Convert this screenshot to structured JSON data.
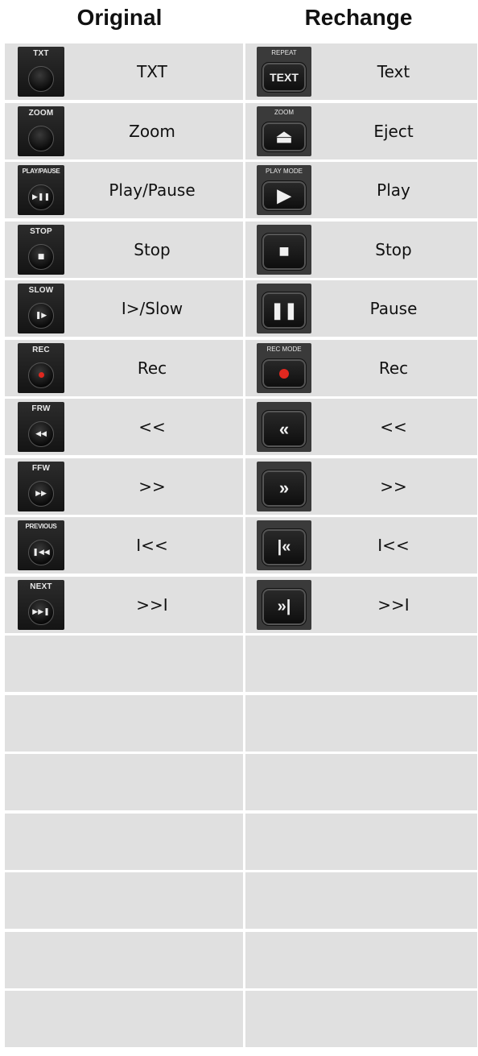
{
  "header": {
    "left_title": "Original",
    "right_title": "Rechange"
  },
  "rows": [
    {
      "original": {
        "icon": "txt-button-icon",
        "caption": "TXT",
        "symbol": "",
        "label": "TXT"
      },
      "rechange": {
        "icon": "repeat-text-button-icon",
        "caption": "REPEAT",
        "symbol": "TEXT",
        "label": "Text"
      }
    },
    {
      "original": {
        "icon": "zoom-button-icon",
        "caption": "ZOOM",
        "symbol": "",
        "label": "Zoom"
      },
      "rechange": {
        "icon": "zoom-eject-button-icon",
        "caption": "ZOOM",
        "symbol": "⏏",
        "label": "Eject"
      }
    },
    {
      "original": {
        "icon": "play-pause-button-icon",
        "caption": "PLAY/PAUSE",
        "symbol": "▶❚❚",
        "label": "Play/Pause"
      },
      "rechange": {
        "icon": "play-mode-button-icon",
        "caption": "PLAY MODE",
        "symbol": "▶",
        "label": "Play"
      }
    },
    {
      "original": {
        "icon": "stop-button-icon",
        "caption": "STOP",
        "symbol": "■",
        "label": "Stop"
      },
      "rechange": {
        "icon": "stop-button-icon",
        "caption": "",
        "symbol": "■",
        "label": "Stop"
      }
    },
    {
      "original": {
        "icon": "slow-button-icon",
        "caption": "SLOW",
        "symbol": "❚▶",
        "label": "I>/Slow"
      },
      "rechange": {
        "icon": "pause-button-icon",
        "caption": "",
        "symbol": "❚❚",
        "label": "Pause"
      }
    },
    {
      "original": {
        "icon": "rec-button-icon",
        "caption": "REC",
        "symbol": "",
        "label": "Rec"
      },
      "rechange": {
        "icon": "rec-mode-button-icon",
        "caption": "REC MODE",
        "symbol": "",
        "label": "Rec"
      }
    },
    {
      "original": {
        "icon": "rewind-button-icon",
        "caption": "FRW",
        "symbol": "◀◀",
        "label": "<<"
      },
      "rechange": {
        "icon": "rewind-button-icon",
        "caption": "",
        "symbol": "«",
        "label": "<<"
      }
    },
    {
      "original": {
        "icon": "fast-forward-button-icon",
        "caption": "FFW",
        "symbol": "▶▶",
        "label": ">>"
      },
      "rechange": {
        "icon": "fast-forward-button-icon",
        "caption": "",
        "symbol": "»",
        "label": ">>"
      }
    },
    {
      "original": {
        "icon": "previous-button-icon",
        "caption": "PREVIOUS",
        "symbol": "❚◀◀",
        "label": "I<<"
      },
      "rechange": {
        "icon": "previous-button-icon",
        "caption": "",
        "symbol": "|«",
        "label": "I<<"
      }
    },
    {
      "original": {
        "icon": "next-button-icon",
        "caption": "NEXT",
        "symbol": "▶▶❚",
        "label": ">>I"
      },
      "rechange": {
        "icon": "next-button-icon",
        "caption": "",
        "symbol": "»|",
        "label": ">>I"
      }
    }
  ],
  "colors": {
    "cell_background": "#e0e0e0",
    "record_red": "#e0281f"
  }
}
